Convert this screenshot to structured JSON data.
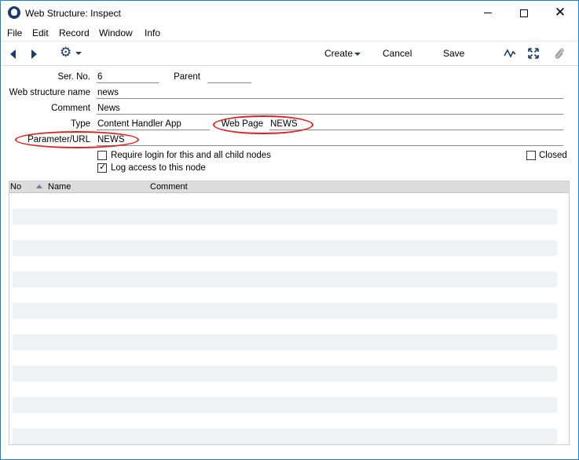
{
  "window": {
    "title": "Web Structure: Inspect",
    "controls": {
      "minimize": "minimize",
      "maximize": "maximize",
      "close": "✕"
    }
  },
  "menu": [
    "File",
    "Edit",
    "Record",
    "Window",
    "Info"
  ],
  "toolbar": {
    "create_label": "Create",
    "cancel_label": "Cancel",
    "save_label": "Save",
    "icons": [
      "back-arrow-icon",
      "forward-arrow-icon",
      "gear-icon",
      "wave-icon",
      "expand-icon",
      "paperclip-icon"
    ]
  },
  "form": {
    "ser_no": {
      "label": "Ser. No.",
      "value": "6"
    },
    "parent": {
      "label": "Parent",
      "value": ""
    },
    "web_structure_name": {
      "label": "Web structure name",
      "value": "news"
    },
    "comment": {
      "label": "Comment",
      "value": "News"
    },
    "type": {
      "label": "Type",
      "value": "Content Handler App"
    },
    "web_page": {
      "label": "Web Page",
      "value": "NEWS"
    },
    "parameter_url": {
      "label": "Parameter/URL",
      "value": "NEWS"
    },
    "require_login": {
      "label": "Require login for this and all child nodes",
      "checked": false
    },
    "log_access": {
      "label": "Log access to this node",
      "checked": true
    },
    "closed": {
      "label": "Closed",
      "checked": false
    }
  },
  "grid": {
    "columns": [
      "No",
      "Name",
      "Comment"
    ],
    "rows": []
  },
  "colors": {
    "highlight_ellipse": "#e02020",
    "accent": "#1f3c66",
    "window_border": "#1883d7"
  }
}
